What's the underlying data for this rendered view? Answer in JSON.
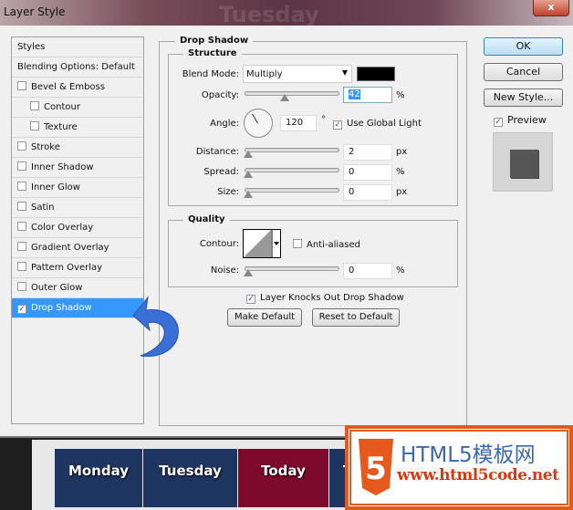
{
  "window": {
    "title": "Layer Style",
    "background_word": "Tuesday",
    "close_label": "x"
  },
  "left_panel": {
    "items": [
      {
        "label": "Styles",
        "checkbox": false
      },
      {
        "label": "Blending Options: Default",
        "checkbox": false
      },
      {
        "label": "Bevel & Emboss",
        "checkbox": true,
        "checked": false
      },
      {
        "label": "Contour",
        "checkbox": true,
        "checked": false,
        "indent": true
      },
      {
        "label": "Texture",
        "checkbox": true,
        "checked": false,
        "indent": true
      },
      {
        "label": "Stroke",
        "checkbox": true,
        "checked": false
      },
      {
        "label": "Inner Shadow",
        "checkbox": true,
        "checked": false
      },
      {
        "label": "Inner Glow",
        "checkbox": true,
        "checked": false
      },
      {
        "label": "Satin",
        "checkbox": true,
        "checked": false
      },
      {
        "label": "Color Overlay",
        "checkbox": true,
        "checked": false
      },
      {
        "label": "Gradient Overlay",
        "checkbox": true,
        "checked": false
      },
      {
        "label": "Pattern Overlay",
        "checkbox": true,
        "checked": false
      },
      {
        "label": "Outer Glow",
        "checkbox": true,
        "checked": false
      },
      {
        "label": "Drop Shadow",
        "checkbox": true,
        "checked": true,
        "selected": true
      }
    ]
  },
  "drop_shadow": {
    "title": "Drop Shadow",
    "structure": {
      "title": "Structure",
      "blend_mode_label": "Blend Mode:",
      "blend_mode": "Multiply",
      "shadow_color": "#000000",
      "opacity_label": "Opacity:",
      "opacity": "42",
      "opacity_unit": "%",
      "angle_label": "Angle:",
      "angle": "120",
      "angle_unit": "°",
      "use_global_light_label": "Use Global Light",
      "use_global_light": true,
      "distance_label": "Distance:",
      "distance": "2",
      "distance_unit": "px",
      "spread_label": "Spread:",
      "spread": "0",
      "spread_unit": "%",
      "size_label": "Size:",
      "size": "0",
      "size_unit": "px"
    },
    "quality": {
      "title": "Quality",
      "contour_label": "Contour:",
      "anti_aliased_label": "Anti-aliased",
      "anti_aliased": false,
      "noise_label": "Noise:",
      "noise": "0",
      "noise_unit": "%"
    },
    "layer_knocks_out_label": "Layer Knocks Out Drop Shadow",
    "layer_knocks_out": true,
    "make_default_label": "Make Default",
    "reset_default_label": "Reset to Default"
  },
  "right": {
    "ok_label": "OK",
    "cancel_label": "Cancel",
    "new_style_label": "New Style...",
    "preview_label": "Preview",
    "preview": true
  },
  "background_tabs": [
    {
      "label": "Monday",
      "color": "#1f3561"
    },
    {
      "label": "Tuesday",
      "color": "#1f3561"
    },
    {
      "label": "Today",
      "color": "#7d0a2c"
    },
    {
      "label": "T",
      "color": "#1f3561"
    }
  ],
  "watermark": {
    "title": "HTML5模板网",
    "url": "www.html5code.net",
    "color": "#e55a1c"
  }
}
